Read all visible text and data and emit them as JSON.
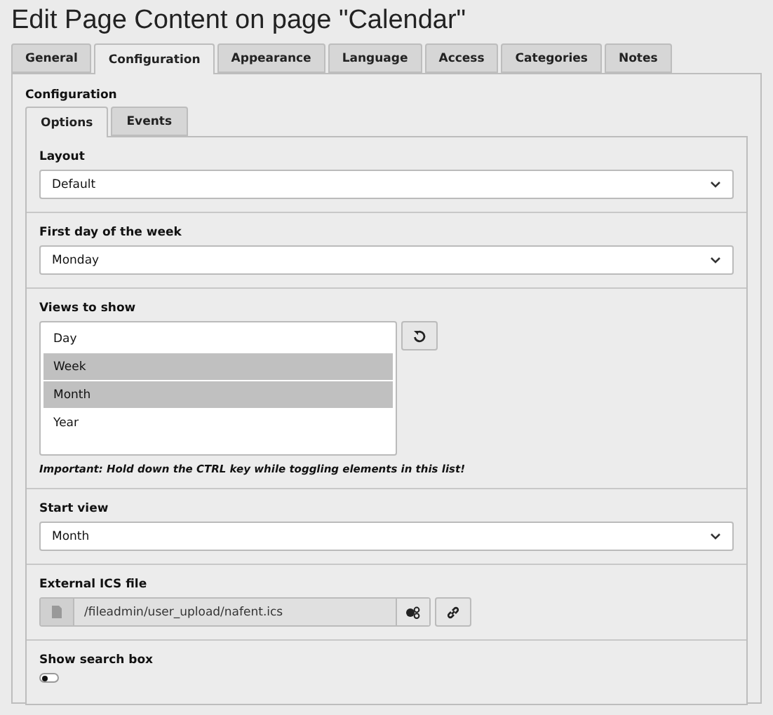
{
  "title": "Edit Page Content on page \"Calendar\"",
  "tabs": [
    {
      "label": "General",
      "selected": false
    },
    {
      "label": "Configuration",
      "selected": true
    },
    {
      "label": "Appearance",
      "selected": false
    },
    {
      "label": "Language",
      "selected": false
    },
    {
      "label": "Access",
      "selected": false
    },
    {
      "label": "Categories",
      "selected": false
    },
    {
      "label": "Notes",
      "selected": false
    }
  ],
  "section_title": "Configuration",
  "subtabs": [
    {
      "label": "Options",
      "selected": true
    },
    {
      "label": "Events",
      "selected": false
    }
  ],
  "fields": [
    {
      "kind": "select",
      "label": "Layout",
      "value": "Default"
    },
    {
      "kind": "select",
      "label": "First day of the week",
      "value": "Monday"
    },
    {
      "kind": "multiselect",
      "label": "Views to show",
      "options": [
        {
          "label": "Day",
          "selected": false
        },
        {
          "label": "Week",
          "selected": true
        },
        {
          "label": "Month",
          "selected": true
        },
        {
          "label": "Year",
          "selected": false
        }
      ],
      "hint": "Important: Hold down the CTRL key while toggling elements in this list!"
    },
    {
      "kind": "select",
      "label": "Start view",
      "value": "Month"
    },
    {
      "kind": "file",
      "label": "External ICS file",
      "value": "/fileadmin/user_upload/nafent.ics"
    },
    {
      "kind": "toggle",
      "label": "Show search box",
      "on": false
    }
  ]
}
